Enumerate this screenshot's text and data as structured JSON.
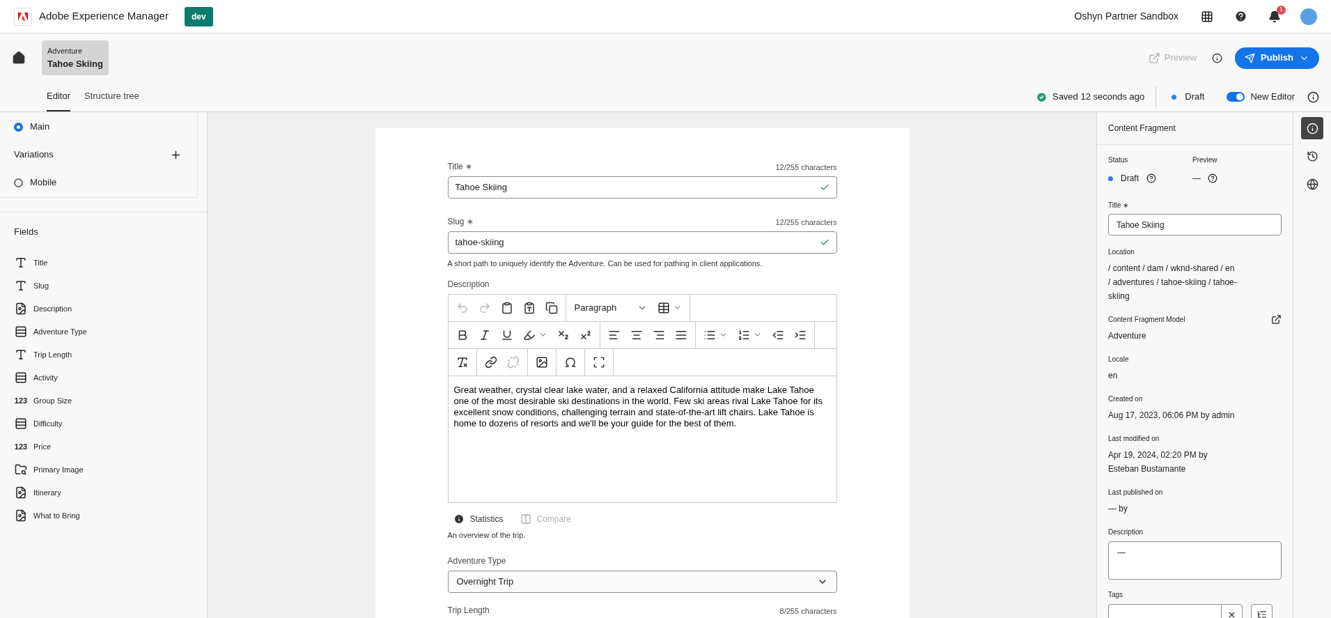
{
  "header": {
    "product": "Adobe Experience Manager",
    "env": "dev",
    "org": "Oshyn Partner Sandbox",
    "notifications": "1"
  },
  "breadcrumb": {
    "type": "Adventure",
    "title": "Tahoe Skiing"
  },
  "actions": {
    "preview": "Preview",
    "preview_disabled": true,
    "publish": "Publish"
  },
  "tabs": [
    {
      "label": "Editor",
      "selected": true
    },
    {
      "label": "Structure tree",
      "selected": false
    }
  ],
  "status": {
    "saved": "Saved 12 seconds ago",
    "state": "Draft",
    "new_editor": "New Editor",
    "new_editor_on": true
  },
  "variations": {
    "main": {
      "label": "Main",
      "selected": true
    },
    "heading": "Variations",
    "items": [
      {
        "label": "Mobile",
        "selected": false
      }
    ]
  },
  "fields_heading": "Fields",
  "fields": [
    {
      "label": "Title",
      "kind": "text"
    },
    {
      "label": "Slug",
      "kind": "text"
    },
    {
      "label": "Description",
      "kind": "richtext"
    },
    {
      "label": "Adventure Type",
      "kind": "enum"
    },
    {
      "label": "Trip Length",
      "kind": "text"
    },
    {
      "label": "Activity",
      "kind": "enum"
    },
    {
      "label": "Group Size",
      "kind": "number",
      "icon_text": "123"
    },
    {
      "label": "Difficulty",
      "kind": "enum"
    },
    {
      "label": "Price",
      "kind": "number",
      "icon_text": "123"
    },
    {
      "label": "Primary Image",
      "kind": "reference"
    },
    {
      "label": "Itinerary",
      "kind": "richtext"
    },
    {
      "label": "What to Bring",
      "kind": "richtext"
    }
  ],
  "form": {
    "title": {
      "label": "Title",
      "required_mark": "∗",
      "count": "12/255 characters",
      "value": "Tahoe Skiing",
      "valid": true
    },
    "slug": {
      "label": "Slug",
      "required_mark": "∗",
      "count": "12/255 characters",
      "value": "tahoe-skiing",
      "valid": true,
      "help": "A short path to uniquely identify the Adventure. Can be used for pathing in client applications."
    },
    "description": {
      "label": "Description",
      "format": "Paragraph",
      "toolbar": [
        {
          "groups": [
            {
              "items": [
                {
                  "kind": "undo",
                  "disabled": true
                },
                {
                  "kind": "redo",
                  "disabled": true
                },
                {
                  "kind": "paste",
                  "disabled": false
                },
                {
                  "kind": "paste-text",
                  "disabled": false
                },
                {
                  "kind": "copy",
                  "disabled": false
                }
              ]
            },
            {
              "items": [
                {
                  "kind": "format",
                  "disabled": false
                },
                {
                  "kind": "table",
                  "disabled": false
                }
              ]
            }
          ]
        },
        {
          "groups": [
            {
              "items": [
                {
                  "kind": "bold",
                  "disabled": false
                },
                {
                  "kind": "italic",
                  "disabled": false
                },
                {
                  "kind": "underline",
                  "disabled": false
                },
                {
                  "kind": "highlight",
                  "disabled": false
                },
                {
                  "kind": "subscript",
                  "disabled": false
                },
                {
                  "kind": "superscript",
                  "disabled": false
                }
              ]
            },
            {
              "items": [
                {
                  "kind": "align-left",
                  "disabled": false
                },
                {
                  "kind": "align-center",
                  "disabled": false
                },
                {
                  "kind": "align-right",
                  "disabled": false
                },
                {
                  "kind": "align-justify",
                  "disabled": false
                }
              ]
            },
            {
              "items": [
                {
                  "kind": "bullets",
                  "disabled": false
                },
                {
                  "kind": "numbers",
                  "disabled": false
                },
                {
                  "kind": "outdent",
                  "disabled": false
                },
                {
                  "kind": "indent",
                  "disabled": false
                }
              ]
            }
          ]
        },
        {
          "groups": [
            {
              "items": [
                {
                  "kind": "clear",
                  "disabled": false
                }
              ]
            },
            {
              "items": [
                {
                  "kind": "link",
                  "disabled": false
                },
                {
                  "kind": "unlink",
                  "disabled": true
                }
              ]
            },
            {
              "items": [
                {
                  "kind": "image",
                  "disabled": false
                }
              ]
            },
            {
              "items": [
                {
                  "kind": "omega",
                  "disabled": false
                }
              ]
            },
            {
              "items": [
                {
                  "kind": "fullscreen",
                  "disabled": false
                }
              ]
            }
          ]
        }
      ],
      "text": "Great weather, crystal clear lake water, and a relaxed California attitude make Lake Tahoe one of the most desirable ski destinations in the world. Few ski areas rival Lake Tahoe for its excellent snow conditions, challenging terrain and state-of-the-art lift chairs. Lake Tahoe is home to dozens of resorts and we'll be your guide for the best of them.",
      "statistics": {
        "label": "Statistics",
        "disabled": false
      },
      "compare": {
        "label": "Compare",
        "disabled": true
      },
      "help": "An overview of the trip."
    },
    "adventure_type": {
      "label": "Adventure Type",
      "value": "Overnight Trip"
    },
    "trip_length": {
      "label": "Trip Length",
      "count": "8/255 characters"
    }
  },
  "panel": {
    "heading": "Content Fragment",
    "status_label": "Status",
    "status": "Draft",
    "preview_label": "Preview",
    "preview": "—",
    "title_label": "Title",
    "title_required_mark": "∗",
    "title": "Tahoe Skiing",
    "details": [
      {
        "label": "Location",
        "value": " / content / dam / wknd-shared / en / adventures / tahoe-skiing / tahoe-skiing"
      },
      {
        "label": "Content Fragment Model",
        "value": "Adventure",
        "link": true
      },
      {
        "label": "Locale",
        "value": "en"
      },
      {
        "label": "Created on",
        "value": "Aug 17, 2023, 06:06 PM by admin"
      },
      {
        "label": "Last modified on",
        "value": "Apr 19, 2024, 02:20 PM by Esteban Bustamante"
      },
      {
        "label": "Last published on",
        "value": "— by"
      }
    ],
    "description_label": "Description",
    "description": "—",
    "tags_label": "Tags"
  },
  "rail": [
    {
      "kind": "info",
      "selected": true
    },
    {
      "kind": "history",
      "selected": false
    },
    {
      "kind": "globe",
      "selected": false
    }
  ]
}
